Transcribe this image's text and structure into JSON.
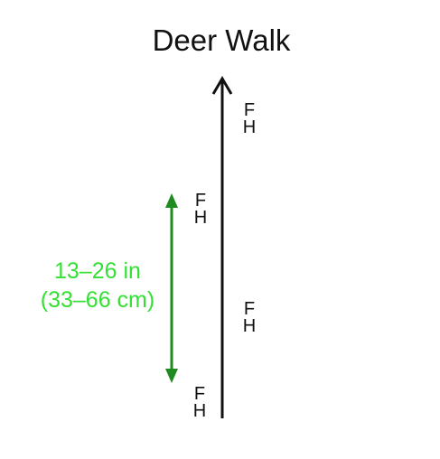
{
  "title": "Deer Walk",
  "tracks": [
    {
      "front": "F",
      "hind": "H"
    },
    {
      "front": "F",
      "hind": "H"
    },
    {
      "front": "F",
      "hind": "H"
    },
    {
      "front": "F",
      "hind": "H"
    }
  ],
  "stride": {
    "imperial": "13–26 in",
    "metric": "(33–66 cm)"
  },
  "colors": {
    "direction_arrow": "#111111",
    "stride_arrow": "#1f8a1f",
    "stride_text": "#33e033"
  }
}
